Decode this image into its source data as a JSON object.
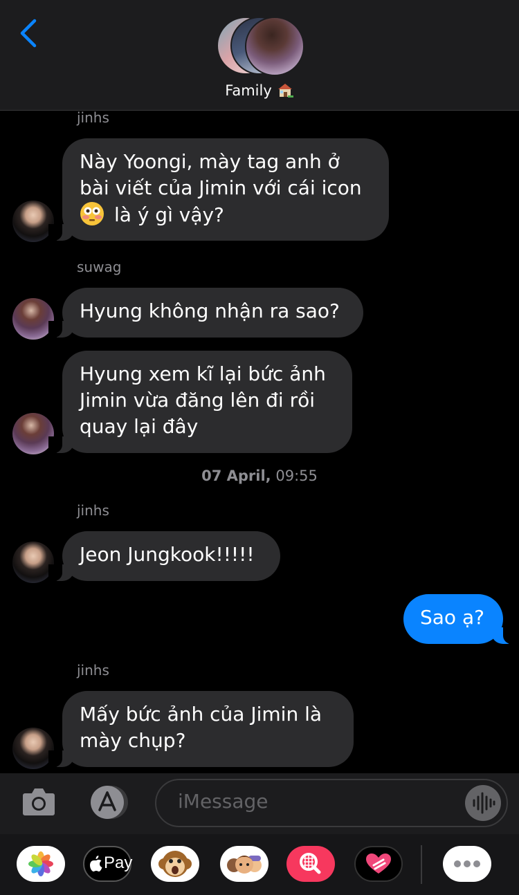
{
  "header": {
    "title": "Family",
    "title_emoji": "house-with-garden"
  },
  "messages": [
    {
      "sender": "jinhs",
      "lines": [
        "Này Yoongi, mày tag anh ở",
        "bài viết của Jimin với cái icon",
        "là ý gì vậy?"
      ],
      "emoji": "flushed-face"
    },
    {
      "sender": "suwag",
      "lines": [
        "Hyung không nhận ra sao?"
      ]
    },
    {
      "lines": [
        "Hyung xem kĩ lại bức ảnh",
        "Jimin vừa đăng lên đi rồi",
        "quay lại đây"
      ]
    },
    {
      "timestamp_day": "07 April,",
      "timestamp_time": "09:55"
    },
    {
      "sender": "jinhs",
      "lines": [
        "Jeon Jungkook!!!!!"
      ]
    },
    {
      "lines": [
        "Sao ạ?"
      ],
      "outgoing": true
    },
    {
      "sender": "jinhs",
      "lines": [
        "Mấy bức ảnh của Jimin là",
        "mày chụp?"
      ]
    }
  ],
  "composer": {
    "placeholder": "iMessage"
  },
  "apps": [
    {
      "icon": "photos-icon"
    },
    {
      "icon": "apple-pay-icon",
      "label": "Pay"
    },
    {
      "icon": "monkey-sticker-icon"
    },
    {
      "icon": "memoji-icon"
    },
    {
      "icon": "image-search-icon"
    },
    {
      "icon": "digital-touch-icon"
    },
    {
      "icon": "more-icon"
    }
  ],
  "colors": {
    "accent": "#0a84ff",
    "bubble_incoming": "#2c2c2e",
    "background": "#000000"
  }
}
